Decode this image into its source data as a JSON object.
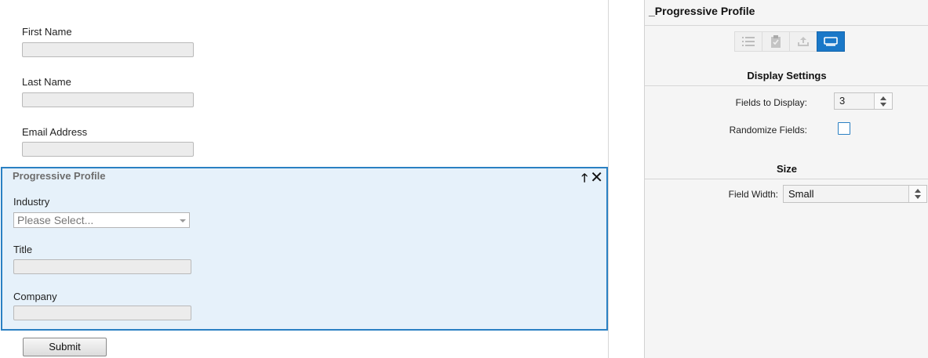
{
  "form": {
    "fields": [
      {
        "label": "First Name"
      },
      {
        "label": "Last Name"
      },
      {
        "label": "Email Address"
      }
    ],
    "progressive_profile": {
      "title": "Progressive Profile",
      "industry_label": "Industry",
      "industry_placeholder": "Please Select...",
      "title_label": "Title",
      "company_label": "Company"
    },
    "submit_label": "Submit"
  },
  "panel": {
    "title": "_Progressive Profile",
    "tools": [
      "list-icon",
      "clipboard-icon",
      "upload-tray-icon",
      "field-box-icon"
    ],
    "display_settings": {
      "heading": "Display Settings",
      "fields_to_display_label": "Fields to Display:",
      "fields_to_display_value": "3",
      "randomize_label": "Randomize Fields:",
      "randomize_checked": false
    },
    "size": {
      "heading": "Size",
      "field_width_label": "Field Width:",
      "field_width_value": "Small"
    }
  },
  "colors": {
    "accent": "#1a78c8",
    "selected_block_bg": "#e6f1fa",
    "selected_block_border": "#2a80c3"
  }
}
